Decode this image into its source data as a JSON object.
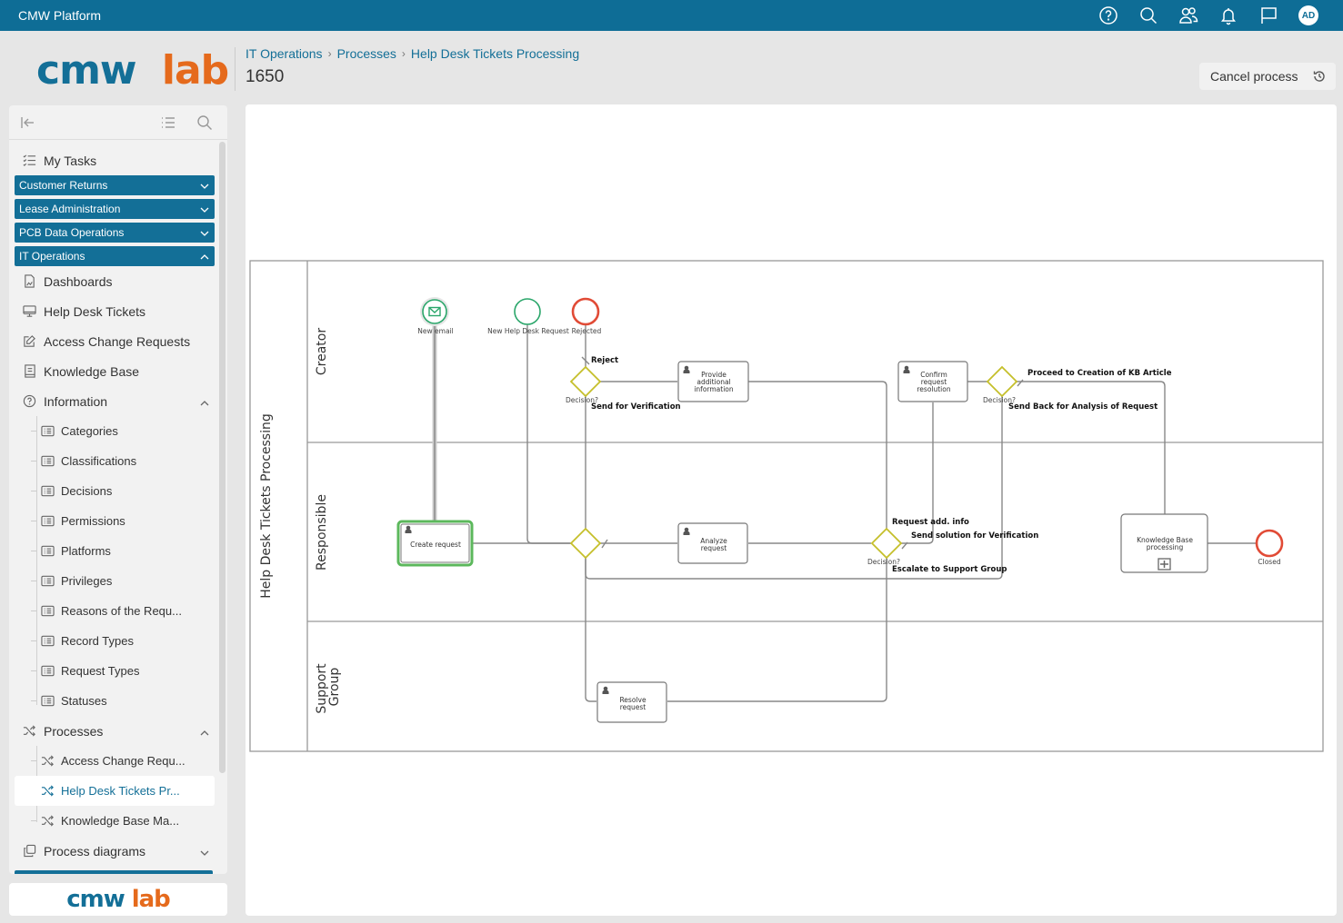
{
  "app": {
    "title": "CMW Platform",
    "topbar_icons": [
      "help-icon",
      "search-icon",
      "users-icon",
      "bell-icon",
      "flag-icon"
    ],
    "user_initials": "AD",
    "brand_colors": {
      "primary": "#136f97",
      "accent": "#e56a1c"
    }
  },
  "header": {
    "logo": {
      "part1": "cmw",
      "part2": "lab"
    },
    "breadcrumb": [
      "IT Operations",
      "Processes",
      "Help Desk Tickets Processing"
    ],
    "page_id": "1650",
    "cancel_button": "Cancel process"
  },
  "sidebar": {
    "my_tasks": "My Tasks",
    "groups": [
      {
        "label": "Customer Returns",
        "expanded": false
      },
      {
        "label": "Lease Administration",
        "expanded": false
      },
      {
        "label": "PCB Data Operations",
        "expanded": false
      },
      {
        "label": "IT Operations",
        "expanded": true
      }
    ],
    "items": [
      {
        "label": "Dashboards",
        "icon": "dashboard-icon"
      },
      {
        "label": "Help Desk Tickets",
        "icon": "monitor-icon"
      },
      {
        "label": "Access Change Requests",
        "icon": "edit-icon"
      },
      {
        "label": "Knowledge Base",
        "icon": "book-icon"
      }
    ],
    "information": {
      "label": "Information",
      "children": [
        "Categories",
        "Classifications",
        "Decisions",
        "Permissions",
        "Platforms",
        "Privileges",
        "Reasons of the Requ...",
        "Record Types",
        "Request Types",
        "Statuses"
      ]
    },
    "processes": {
      "label": "Processes",
      "children": [
        "Access Change Requ...",
        "Help Desk Tickets Pr...",
        "Knowledge Base Ma..."
      ],
      "active_index": 1
    },
    "process_diagrams": "Process diagrams",
    "footer_logo": {
      "part1": "cmw",
      "part2": "lab"
    }
  },
  "diagram": {
    "pool": "Help Desk Tickets Processing",
    "lanes": [
      "Creator",
      "Responsible",
      "Support Group"
    ],
    "events": {
      "new_email": "New email",
      "new_request": "New Help Desk Request",
      "rejected": "Rejected",
      "closed": "Closed"
    },
    "tasks": {
      "create_request": "Create request",
      "provide_info_1": "Provide",
      "provide_info_2": "additional",
      "provide_info_3": "information",
      "confirm_1": "Confirm",
      "confirm_2": "request",
      "confirm_3": "resolution",
      "analyze_1": "Analyze",
      "analyze_2": "request",
      "resolve_1": "Resolve",
      "resolve_2": "request",
      "kb_1": "Knowledge Base",
      "kb_2": "processing"
    },
    "gateways": {
      "decision_label": "Decision?"
    },
    "flows": {
      "reject": "Reject",
      "send_for_verification": "Send for Verification",
      "proceed_kb": "Proceed to Creation of KB Article",
      "send_back": "Send Back for Analysis of Request",
      "request_add_info": "Request add. info",
      "send_solution": "Send solution for Verification",
      "escalate": "Escalate to Support Group"
    }
  }
}
